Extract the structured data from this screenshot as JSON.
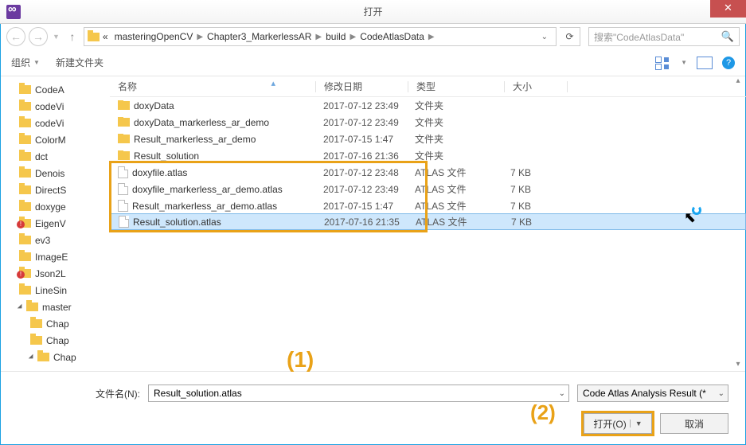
{
  "title": "打开",
  "breadcrumb": {
    "prefix": "«",
    "parts": [
      "masteringOpenCV",
      "Chapter3_MarkerlessAR",
      "build",
      "CodeAtlasData"
    ]
  },
  "search": {
    "placeholder": "搜索\"CodeAtlasData\""
  },
  "toolbar": {
    "organize": "组织",
    "new_folder": "新建文件夹"
  },
  "tree": [
    {
      "label": "CodeA",
      "indent": 1
    },
    {
      "label": "codeVi",
      "indent": 1
    },
    {
      "label": "codeVi",
      "indent": 1
    },
    {
      "label": "ColorM",
      "indent": 1
    },
    {
      "label": "dct",
      "indent": 1
    },
    {
      "label": "Denois",
      "indent": 1
    },
    {
      "label": "DirectS",
      "indent": 1
    },
    {
      "label": "doxyge",
      "indent": 1
    },
    {
      "label": "EigenV",
      "indent": 1,
      "err": true
    },
    {
      "label": "ev3",
      "indent": 1
    },
    {
      "label": "ImageE",
      "indent": 1
    },
    {
      "label": "Json2L",
      "indent": 1,
      "err": true
    },
    {
      "label": "LineSin",
      "indent": 1
    },
    {
      "label": "master",
      "indent": 1,
      "open": true
    },
    {
      "label": "Chap",
      "indent": 2
    },
    {
      "label": "Chap",
      "indent": 2
    },
    {
      "label": "Chap",
      "indent": 2,
      "open": true
    }
  ],
  "columns": {
    "name": "名称",
    "date": "修改日期",
    "type": "类型",
    "size": "大小"
  },
  "files": [
    {
      "name": "doxyData",
      "date": "2017-07-12 23:49",
      "type": "文件夹",
      "size": "",
      "kind": "folder"
    },
    {
      "name": "doxyData_markerless_ar_demo",
      "date": "2017-07-12 23:49",
      "type": "文件夹",
      "size": "",
      "kind": "folder"
    },
    {
      "name": "Result_markerless_ar_demo",
      "date": "2017-07-15 1:47",
      "type": "文件夹",
      "size": "",
      "kind": "folder"
    },
    {
      "name": "Result_solution",
      "date": "2017-07-16 21:36",
      "type": "文件夹",
      "size": "",
      "kind": "folder"
    },
    {
      "name": "doxyfile.atlas",
      "date": "2017-07-12 23:48",
      "type": "ATLAS 文件",
      "size": "7 KB",
      "kind": "file"
    },
    {
      "name": "doxyfile_markerless_ar_demo.atlas",
      "date": "2017-07-12 23:49",
      "type": "ATLAS 文件",
      "size": "7 KB",
      "kind": "file"
    },
    {
      "name": "Result_markerless_ar_demo.atlas",
      "date": "2017-07-15 1:47",
      "type": "ATLAS 文件",
      "size": "7 KB",
      "kind": "file"
    },
    {
      "name": "Result_solution.atlas",
      "date": "2017-07-16 21:35",
      "type": "ATLAS 文件",
      "size": "7 KB",
      "kind": "file",
      "selected": true
    }
  ],
  "annotations": {
    "a1": "(1)",
    "a2": "(2)"
  },
  "bottom": {
    "filename_label": "文件名(N):",
    "filename_value": "Result_solution.atlas",
    "filetype_value": "Code Atlas Analysis Result (*",
    "open_btn": "打开(O)",
    "cancel_btn": "取消"
  }
}
